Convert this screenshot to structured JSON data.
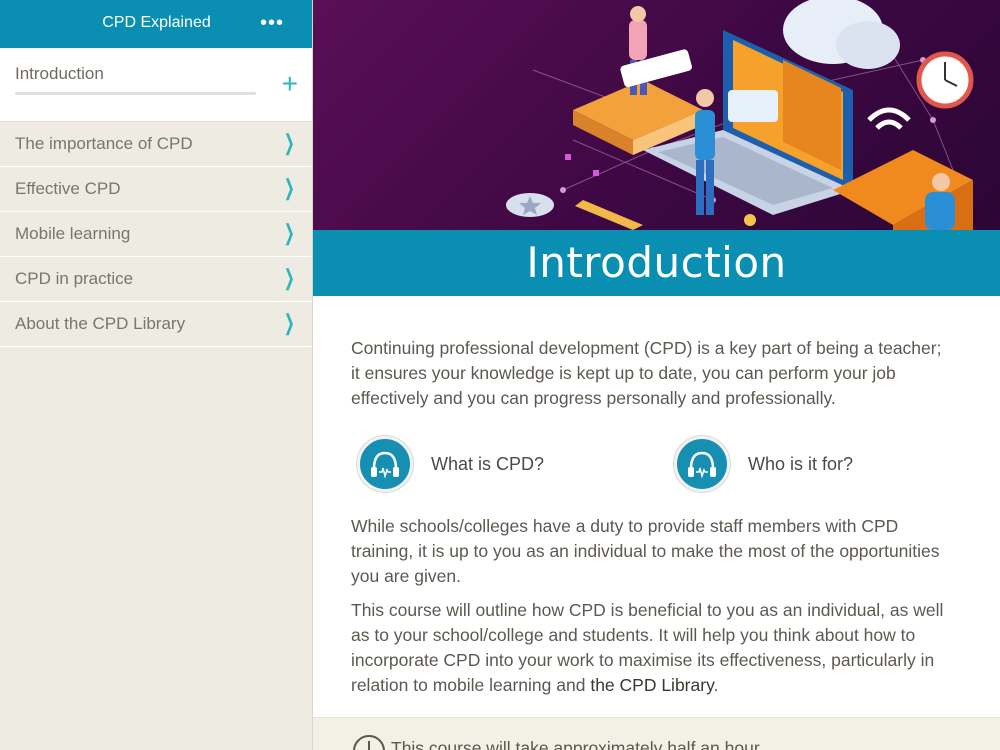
{
  "sidebar": {
    "title": "CPD Explained",
    "more_icon": "more-dots-icon",
    "intro": {
      "label": "Introduction",
      "plus_icon": "+"
    },
    "items": [
      {
        "label": "The importance of CPD"
      },
      {
        "label": "Effective CPD"
      },
      {
        "label": "Mobile learning"
      },
      {
        "label": "CPD in practice"
      },
      {
        "label": "About the CPD Library"
      }
    ],
    "chevron": "❯"
  },
  "main": {
    "title": "Introduction",
    "paragraph1": "Continuing professional development (CPD) is a key part of being a teacher; it ensures your knowledge is kept up to date, you can perform your job effectively and you can progress personally and professionally.",
    "audio": [
      {
        "label": "What is CPD?",
        "icon": "headphones-icon"
      },
      {
        "label": "Who is it for?",
        "icon": "headphones-icon"
      }
    ],
    "paragraph2": "While schools/colleges have a duty to provide staff members with CPD training, it is up to you as an individual to make the most of the opportunities you are given.",
    "paragraph3_prefix": "This course will outline how CPD is beneficial to you as an individual, as well as to your school/college and students. It will help you think about how to incorporate CPD into your work to maximise its effectiveness, particularly in relation to mobile learning and ",
    "paragraph3_link": "the CPD Library",
    "paragraph3_suffix": ".",
    "note": "This course will take approximately half an hour."
  },
  "colors": {
    "accent": "#0a8fb3",
    "sidebar_bg": "#eeebe3",
    "chevron": "#2cb6c0",
    "hero_bg": "#4a0b4d"
  }
}
